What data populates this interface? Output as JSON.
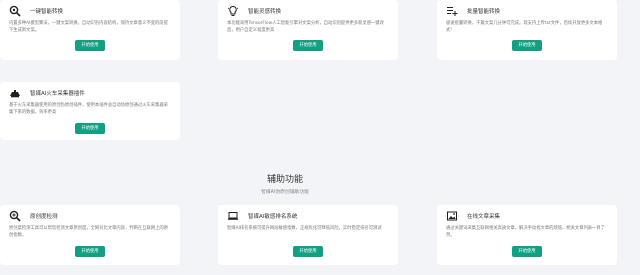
{
  "top_cards": [
    {
      "title": "一键智能转换",
      "desc": "内置多种AI模型算法，一键文案转换，自动识别内容结构，保持文章意义不变的前提下生成新文案。",
      "button": "开始使用",
      "icon": "search-convert-icon"
    },
    {
      "title": "智能灵感转换",
      "desc": "本功能采用TensorFlow人工智能引擎对文案分析，自动识别提供更多新灵感一键改造，用户自定义程度更高",
      "button": "开始使用",
      "icon": "lightbulb-icon"
    },
    {
      "title": "批量智能转换",
      "desc": "极速批量转换，千篇文案几分钟可完成。现支持上传txt文件，后续开放更多文本格式!",
      "button": "开始使用",
      "icon": "list-plus-icon"
    }
  ],
  "middle_card": {
    "title": "智媒AI火车采集器插件",
    "desc": "基于火车采集器使用的原创伪原创插件，使用本插件会自动伪原创通过火车采集器采集下来的数据，效率更高",
    "button": "开始使用",
    "icon": "train-icon"
  },
  "section": {
    "title": "辅助功能",
    "subtitle": "智媒AI伪原创辅助功能"
  },
  "bottom_cards": [
    {
      "title": "原创度检测",
      "desc": "原创度检测工具可以帮您检测文章原创度，全网对比文章内容，判断在互联网上的原创指数。",
      "button": "开始使用",
      "icon": "zoom-icon"
    },
    {
      "title": "智媒AI敏感排名系统",
      "desc": "智媒AI排名系统可提升网站敏感指数，正规优化可降低风险，实时稳定排名可测试",
      "button": "开始使用",
      "icon": "laptop-icon"
    },
    {
      "title": "在线文章采集",
      "desc": "通过关键词采集互联网相关高质文章，解决手动找文章的烦恼，相关文章列表一目了然。",
      "button": "开始使用",
      "icon": "image-icon"
    }
  ]
}
